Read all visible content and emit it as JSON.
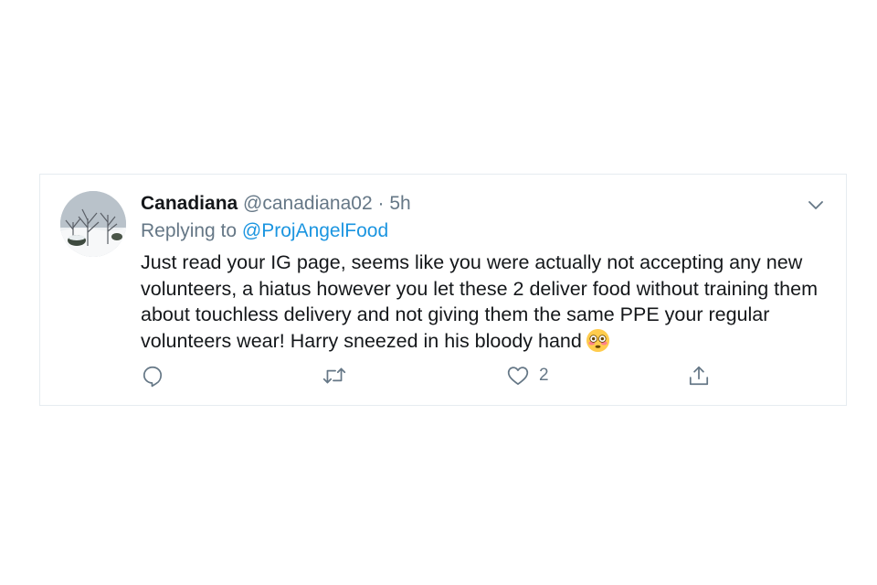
{
  "tweet": {
    "display_name": "Canadiana",
    "handle": "@canadiana02",
    "separator": "·",
    "time": "5h",
    "replying_prefix": "Replying to ",
    "replying_to": "@ProjAngelFood",
    "text": "Just read your IG page, seems like you were actually not accepting any new volunteers, a hiatus however you let these 2 deliver food without training them about touchless delivery and not giving them the same PPE your regular volunteers wear!  Harry sneezed in his bloody hand",
    "emoji": "flushed-face-emoji",
    "avatar": "snowy-trees-photo"
  },
  "actions": {
    "reply": {
      "icon": "reply-icon",
      "count": ""
    },
    "retweet": {
      "icon": "retweet-icon",
      "count": ""
    },
    "like": {
      "icon": "heart-icon",
      "count": "2"
    },
    "share": {
      "icon": "share-icon",
      "count": ""
    }
  },
  "colors": {
    "text": "#14171a",
    "secondary": "#657786",
    "link": "#1b95e0",
    "border": "#e6ecf0"
  }
}
